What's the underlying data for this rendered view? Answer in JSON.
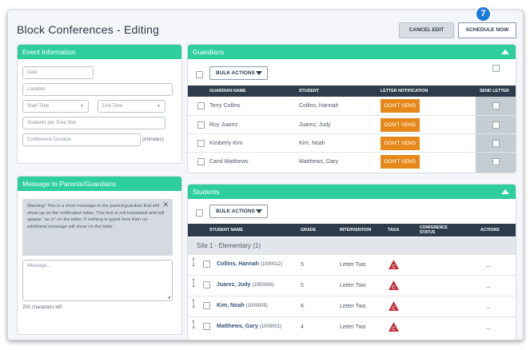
{
  "header": {
    "title": "Block Conferences - Editing",
    "cancel_label": "CANCEL EDIT",
    "schedule_label": "SCHEDULE NOW",
    "step_badge": "7"
  },
  "event_info": {
    "title": "Event Information",
    "date_placeholder": "Date",
    "location_placeholder": "Location",
    "start_time_placeholder": "Start Time",
    "end_time_placeholder": "End Time",
    "students_per_slot_placeholder": "Students per Time Slot",
    "duration_placeholder": "Conference Duration",
    "duration_unit": "(minutes)"
  },
  "message": {
    "title": "Message to Parents/Guardians",
    "warning": "Warning! This is a short message to the parent/guardian that will show up on the notification letter. This text is not translated and will appear \"as is\" on the letter. If nothing is typed here then no additional message will show on the letter.",
    "placeholder": "Message...",
    "chars_left": "250 characters left"
  },
  "guardians": {
    "title": "Guardians",
    "bulk_label": "BULK ACTIONS",
    "columns": [
      "GUARDIAN NAME",
      "STUDENT",
      "LETTER NOTIFICATION",
      "SEND LETTER"
    ],
    "rows": [
      {
        "name": "Terry Collins",
        "student": "Collins, Hannah",
        "notification": "DON'T SEND"
      },
      {
        "name": "Roy Juarez",
        "student": "Juarez, Judy",
        "notification": "DON'T SEND"
      },
      {
        "name": "Kimberly Kim",
        "student": "Kim, Noah",
        "notification": "DON'T SEND"
      },
      {
        "name": "Carol Matthews",
        "student": "Matthews, Gary",
        "notification": "DON'T SEND"
      }
    ]
  },
  "students": {
    "title": "Students",
    "bulk_label": "BULK ACTIONS",
    "columns": {
      "name": "STUDENT NAME",
      "grade": "GRADE",
      "intervention": "INTERVENTION",
      "tags": "TAGS",
      "status_line1": "CONFERENCE",
      "status_line2": "STATUS",
      "actions": "ACTIONS"
    },
    "site": "Site 1 - Elementary (1)",
    "rows": [
      {
        "name": "Collins, Hannah",
        "id": "(1000012)",
        "grade": "5",
        "intervention": "Letter Two",
        "tag": "C",
        "actions": "..."
      },
      {
        "name": "Juarez, Judy",
        "id": "(1000006)",
        "grade": "5",
        "intervention": "Letter Two",
        "tag": "C",
        "actions": "..."
      },
      {
        "name": "Kim, Noah",
        "id": "(1000005)",
        "grade": "K",
        "intervention": "Letter Two",
        "tag": "C",
        "actions": "..."
      },
      {
        "name": "Matthews, Gary",
        "id": "(1000001)",
        "grade": "4",
        "intervention": "Letter Two",
        "tag": "C",
        "actions": "..."
      }
    ]
  },
  "colors": {
    "accent_green": "#2ecf9c",
    "header_dark": "#2d3b4c",
    "dont_send_orange": "#e6891a",
    "tag_red": "#c0323e",
    "badge_blue": "#1d7bd8"
  }
}
